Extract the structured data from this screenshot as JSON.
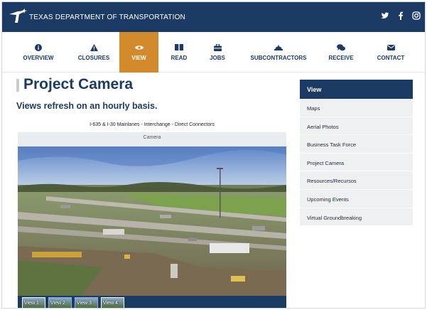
{
  "header": {
    "site_title": "TEXAS DEPARTMENT OF TRANSPORTATION",
    "social_icons": [
      "twitter-icon",
      "facebook-icon",
      "instagram-icon"
    ]
  },
  "nav": {
    "items": [
      {
        "label": "OVERVIEW",
        "icon": "info-icon"
      },
      {
        "label": "CLOSURES",
        "icon": "warning-icon"
      },
      {
        "label": "VIEW",
        "icon": "eye-icon",
        "active": true
      },
      {
        "label": "READ",
        "icon": "book-icon"
      },
      {
        "label": "JOBS",
        "icon": "briefcase-icon"
      },
      {
        "label": "SUBCONTRACTORS",
        "icon": "hardhat-icon"
      },
      {
        "label": "RECEIVE",
        "icon": "chat-icon"
      },
      {
        "label": "CONTACT",
        "icon": "mail-icon"
      }
    ],
    "active_color": "#d38a2c"
  },
  "main": {
    "title": "Project Camera",
    "subtitle": "Views refresh on an hourly basis.",
    "camera_caption": "I-635 & I-30 Mainlanes - Interchange - Direct Connectors",
    "camera_label": "Camera",
    "thumbnails": [
      {
        "label": "View 1",
        "selected": true
      },
      {
        "label": "View 2"
      },
      {
        "label": "View 3"
      },
      {
        "label": "View 4"
      }
    ]
  },
  "sidebar": {
    "heading": "View",
    "items": [
      "Maps",
      "Aerial Photos",
      "Business Task Force",
      "Project Camera",
      "Resources/Recursos",
      "Upcoming Events",
      "Virtual Groundbreaking"
    ]
  },
  "colors": {
    "brand_navy": "#1c3b64",
    "accent_orange": "#d38a2c",
    "sidebar_bg": "#eef0f2"
  }
}
